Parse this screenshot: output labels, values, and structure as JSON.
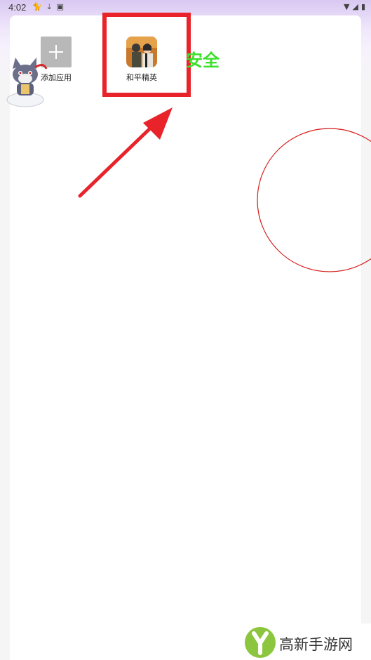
{
  "status_bar": {
    "time": "4:02",
    "left_icons": [
      "cat-notification-icon",
      "download-icon",
      "a-box-icon"
    ],
    "right_icons": [
      "wifi-icon",
      "signal-icon",
      "battery-icon"
    ]
  },
  "apps": [
    {
      "label": "添加应用",
      "icon": "add-icon"
    },
    {
      "label": "和平精英",
      "icon": "game-icon"
    }
  ],
  "annotation": {
    "safe_label": "安全",
    "highlight_color": "#e8232a",
    "safe_color": "#3be02a"
  },
  "watermark": {
    "text": "高新手游网"
  }
}
